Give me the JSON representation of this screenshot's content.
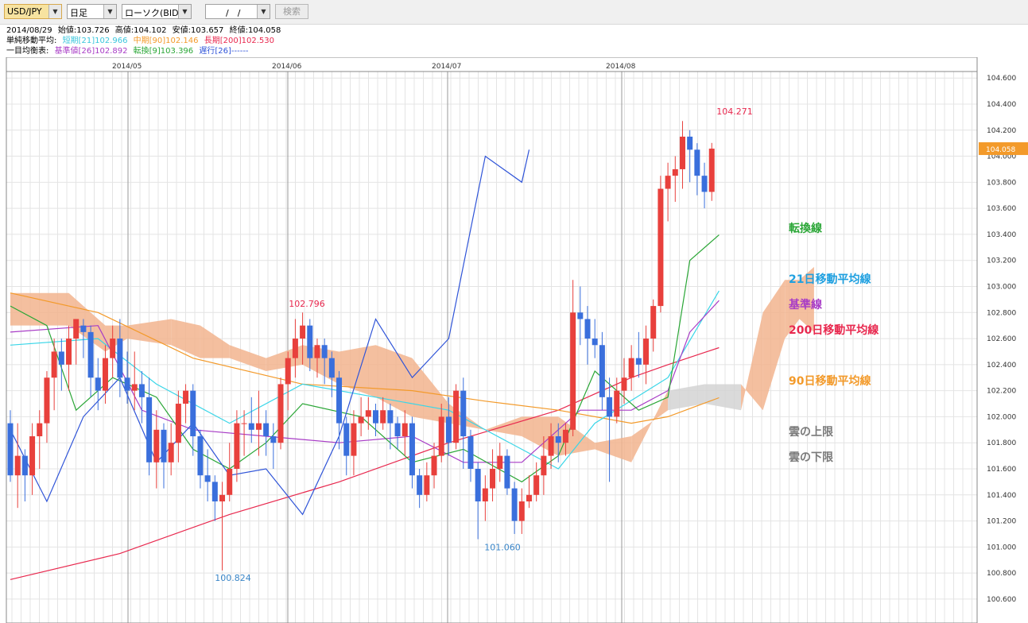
{
  "toolbar": {
    "symbol": "USD/JPY",
    "timeframe": "日足",
    "chart_type": "ローソク(BID)",
    "date": "　/　/",
    "search_label": "検索"
  },
  "info": {
    "date": "2014/08/29",
    "open_label": "始値:",
    "open": "103.726",
    "high_label": "高値:",
    "high": "104.102",
    "low_label": "安値:",
    "low": "103.657",
    "close_label": "終値:",
    "close": "104.058",
    "sma_label": "単純移動平均:",
    "sma_short": "短期[21]102.966",
    "sma_mid": "中期[90]102.146",
    "sma_long": "長期[200]102.530",
    "ichimoku_label": "一目均衡表:",
    "kijun": "基準値[26]102.892",
    "tenkan": "転換[9]103.396",
    "chikou": "遅行[26]------"
  },
  "legend": {
    "tenkan": "転換線",
    "sma21": "21日移動平均線",
    "kijun": "基準線",
    "sma200": "200日移動平均線",
    "sma90": "90日移動平均線",
    "cloud_upper": "雲の上限",
    "cloud_lower": "雲の下限"
  },
  "colors": {
    "up": "#e8403c",
    "down": "#3a6fdc",
    "sma21": "#39d6e8",
    "sma90": "#f39a2a",
    "sma200": "#e8284e",
    "tenkan": "#2aa636",
    "kijun": "#a83cc6",
    "chikou": "#2f54d8",
    "cloud_bull": "#f2b48e",
    "cloud_bear": "#d4d4d4",
    "current": "#f39a2a"
  },
  "chart_data": {
    "type": "candlestick",
    "ylim": [
      100.5,
      104.65
    ],
    "y_ticks": [
      "100.600",
      "100.800",
      "101.000",
      "101.200",
      "101.400",
      "101.600",
      "101.800",
      "102.000",
      "102.200",
      "102.400",
      "102.600",
      "102.800",
      "103.000",
      "103.200",
      "103.400",
      "103.600",
      "103.800",
      "104.000",
      "104.200",
      "104.400",
      "104.600"
    ],
    "months": [
      "2014/05",
      "2014/06",
      "2014/07",
      "2014/08"
    ],
    "current_price": "104.058",
    "annotations": [
      {
        "text": "104.271",
        "price": 104.271,
        "color": "#e8284e"
      },
      {
        "text": "102.796",
        "price": 102.796,
        "color": "#e8284e"
      },
      {
        "text": "100.824",
        "price": 100.824,
        "color": "#3a86c8"
      },
      {
        "text": "101.060",
        "price": 101.06,
        "color": "#3a86c8"
      }
    ],
    "candles": [
      [
        101.95,
        101.55,
        102.05,
        101.5
      ],
      [
        101.55,
        101.7,
        101.95,
        101.3
      ],
      [
        101.7,
        101.55,
        101.75,
        101.35
      ],
      [
        101.55,
        101.85,
        101.95,
        101.4
      ],
      [
        101.85,
        101.95,
        102.05,
        101.6
      ],
      [
        101.95,
        102.3,
        102.35,
        101.8
      ],
      [
        102.3,
        102.5,
        102.6,
        102.05
      ],
      [
        102.5,
        102.4,
        102.6,
        102.2
      ],
      [
        102.4,
        102.6,
        102.7,
        102.2
      ],
      [
        102.6,
        102.75,
        102.75,
        102.4
      ],
      [
        102.7,
        102.65,
        102.75,
        102.45
      ],
      [
        102.65,
        102.3,
        102.7,
        102.15
      ],
      [
        102.3,
        102.2,
        102.45,
        102.05
      ],
      [
        102.2,
        102.45,
        102.55,
        102.1
      ],
      [
        102.45,
        102.6,
        102.7,
        102.3
      ],
      [
        102.6,
        102.3,
        102.75,
        102.15
      ],
      [
        102.3,
        102.2,
        102.5,
        102.1
      ],
      [
        102.2,
        102.25,
        102.5,
        102.05
      ],
      [
        102.25,
        102.15,
        102.35,
        101.95
      ],
      [
        102.15,
        101.65,
        102.3,
        101.55
      ],
      [
        101.65,
        101.9,
        102.05,
        101.45
      ],
      [
        101.9,
        101.65,
        101.95,
        101.45
      ],
      [
        101.65,
        101.8,
        101.95,
        101.55
      ],
      [
        101.8,
        102.1,
        102.2,
        101.65
      ],
      [
        102.1,
        102.2,
        102.25,
        101.95
      ],
      [
        102.2,
        101.85,
        102.25,
        101.7
      ],
      [
        101.85,
        101.55,
        101.9,
        101.45
      ],
      [
        101.55,
        101.5,
        101.75,
        101.35
      ],
      [
        101.5,
        101.35,
        101.55,
        101.2
      ],
      [
        101.35,
        101.4,
        101.5,
        100.82
      ],
      [
        101.4,
        101.6,
        101.8,
        101.35
      ],
      [
        101.6,
        101.95,
        102.05,
        101.5
      ],
      [
        101.95,
        101.95,
        102.05,
        101.7
      ],
      [
        101.95,
        101.9,
        102.15,
        101.8
      ],
      [
        101.9,
        101.95,
        102.2,
        101.7
      ],
      [
        101.95,
        101.85,
        102.05,
        101.7
      ],
      [
        101.85,
        101.8,
        101.95,
        101.6
      ],
      [
        101.8,
        102.25,
        102.3,
        101.75
      ],
      [
        102.25,
        102.45,
        102.5,
        102.05
      ],
      [
        102.45,
        102.6,
        102.75,
        102.3
      ],
      [
        102.6,
        102.7,
        102.8,
        102.4
      ],
      [
        102.7,
        102.45,
        102.75,
        102.35
      ],
      [
        102.45,
        102.55,
        102.6,
        102.3
      ],
      [
        102.55,
        102.45,
        102.6,
        102.25
      ],
      [
        102.45,
        102.3,
        102.5,
        102.15
      ],
      [
        102.3,
        101.95,
        102.35,
        101.75
      ],
      [
        101.95,
        101.7,
        102.0,
        101.55
      ],
      [
        101.7,
        101.95,
        102.05,
        101.55
      ],
      [
        101.95,
        102.0,
        102.15,
        101.85
      ],
      [
        102.0,
        102.05,
        102.15,
        101.9
      ],
      [
        102.05,
        101.95,
        102.1,
        101.85
      ],
      [
        101.95,
        102.05,
        102.15,
        101.9
      ],
      [
        102.05,
        101.95,
        102.1,
        101.75
      ],
      [
        101.95,
        101.85,
        102.0,
        101.75
      ],
      [
        101.85,
        101.95,
        102.05,
        101.7
      ],
      [
        101.95,
        101.55,
        102.0,
        101.45
      ],
      [
        101.55,
        101.4,
        101.6,
        101.3
      ],
      [
        101.4,
        101.55,
        101.65,
        101.35
      ],
      [
        101.55,
        101.7,
        101.8,
        101.45
      ],
      [
        101.7,
        102.0,
        102.1,
        101.65
      ],
      [
        102.0,
        101.8,
        102.15,
        101.7
      ],
      [
        101.8,
        102.2,
        102.25,
        101.75
      ],
      [
        102.2,
        101.85,
        102.3,
        101.6
      ],
      [
        101.85,
        101.6,
        101.9,
        101.5
      ],
      [
        101.6,
        101.35,
        101.65,
        101.06
      ],
      [
        101.35,
        101.45,
        101.55,
        101.2
      ],
      [
        101.45,
        101.6,
        101.75,
        101.35
      ],
      [
        101.6,
        101.7,
        101.8,
        101.5
      ],
      [
        101.7,
        101.45,
        101.75,
        101.4
      ],
      [
        101.45,
        101.2,
        101.5,
        101.1
      ],
      [
        101.2,
        101.35,
        101.45,
        101.1
      ],
      [
        101.35,
        101.4,
        101.55,
        101.3
      ],
      [
        101.4,
        101.55,
        101.65,
        101.35
      ],
      [
        101.55,
        101.7,
        101.85,
        101.4
      ],
      [
        101.7,
        101.85,
        101.95,
        101.6
      ],
      [
        101.85,
        101.8,
        101.95,
        101.65
      ],
      [
        101.8,
        101.9,
        101.95,
        101.7
      ],
      [
        101.9,
        102.8,
        103.05,
        101.85
      ],
      [
        102.8,
        102.75,
        103.0,
        102.55
      ],
      [
        102.75,
        102.6,
        102.85,
        102.4
      ],
      [
        102.6,
        102.55,
        102.75,
        102.45
      ],
      [
        102.55,
        102.15,
        102.65,
        102.05
      ],
      [
        102.15,
        102.0,
        102.3,
        101.5
      ],
      [
        102.0,
        102.2,
        102.3,
        101.95
      ],
      [
        102.2,
        102.3,
        102.45,
        102.1
      ],
      [
        102.3,
        102.45,
        102.55,
        102.2
      ],
      [
        102.45,
        102.4,
        102.65,
        102.3
      ],
      [
        102.4,
        102.6,
        102.7,
        102.25
      ],
      [
        102.6,
        102.85,
        102.9,
        102.5
      ],
      [
        102.85,
        103.75,
        103.85,
        102.8
      ],
      [
        103.75,
        103.85,
        103.95,
        103.5
      ],
      [
        103.85,
        103.9,
        104.0,
        103.65
      ],
      [
        103.9,
        104.15,
        104.27,
        103.75
      ],
      [
        104.15,
        104.05,
        104.2,
        103.8
      ],
      [
        104.05,
        103.85,
        104.1,
        103.7
      ],
      [
        103.85,
        103.726,
        103.95,
        103.6
      ],
      [
        103.726,
        104.058,
        104.102,
        103.657
      ]
    ],
    "sma21": [
      [
        0,
        102.55
      ],
      [
        12,
        102.6
      ],
      [
        20,
        102.25
      ],
      [
        30,
        101.95
      ],
      [
        40,
        102.25
      ],
      [
        50,
        102.15
      ],
      [
        60,
        102.05
      ],
      [
        70,
        101.75
      ],
      [
        75,
        101.6
      ],
      [
        80,
        101.95
      ],
      [
        90,
        102.3
      ],
      [
        97,
        102.966
      ]
    ],
    "sma90": [
      [
        0,
        102.95
      ],
      [
        12,
        102.8
      ],
      [
        25,
        102.45
      ],
      [
        40,
        102.25
      ],
      [
        55,
        102.2
      ],
      [
        65,
        102.12
      ],
      [
        75,
        102.05
      ],
      [
        85,
        101.95
      ],
      [
        90,
        102.0
      ],
      [
        97,
        102.146
      ]
    ],
    "sma200": [
      [
        0,
        100.75
      ],
      [
        15,
        100.95
      ],
      [
        30,
        101.25
      ],
      [
        45,
        101.5
      ],
      [
        60,
        101.8
      ],
      [
        75,
        102.05
      ],
      [
        85,
        102.3
      ],
      [
        90,
        102.4
      ],
      [
        97,
        102.53
      ]
    ],
    "tenkan": [
      [
        0,
        102.85
      ],
      [
        5,
        102.7
      ],
      [
        9,
        102.05
      ],
      [
        14,
        102.3
      ],
      [
        20,
        102.15
      ],
      [
        25,
        101.75
      ],
      [
        30,
        101.6
      ],
      [
        35,
        101.8
      ],
      [
        40,
        102.1
      ],
      [
        48,
        102.0
      ],
      [
        55,
        101.65
      ],
      [
        62,
        101.75
      ],
      [
        70,
        101.5
      ],
      [
        75,
        101.7
      ],
      [
        80,
        102.35
      ],
      [
        86,
        102.05
      ],
      [
        90,
        102.15
      ],
      [
        93,
        103.2
      ],
      [
        97,
        103.396
      ]
    ],
    "kijun": [
      [
        0,
        102.65
      ],
      [
        12,
        102.7
      ],
      [
        18,
        102.05
      ],
      [
        25,
        101.9
      ],
      [
        35,
        101.85
      ],
      [
        45,
        101.8
      ],
      [
        55,
        101.85
      ],
      [
        62,
        101.65
      ],
      [
        70,
        101.65
      ],
      [
        78,
        102.05
      ],
      [
        85,
        102.05
      ],
      [
        90,
        102.2
      ],
      [
        93,
        102.65
      ],
      [
        97,
        102.892
      ]
    ],
    "chikou": [
      [
        0,
        101.9
      ],
      [
        5,
        101.35
      ],
      [
        10,
        102.0
      ],
      [
        15,
        102.3
      ],
      [
        20,
        101.65
      ],
      [
        25,
        101.95
      ],
      [
        30,
        101.55
      ],
      [
        35,
        101.6
      ],
      [
        40,
        101.25
      ],
      [
        45,
        101.85
      ],
      [
        50,
        102.75
      ],
      [
        55,
        102.3
      ],
      [
        60,
        102.6
      ],
      [
        65,
        104.0
      ],
      [
        70,
        103.8
      ],
      [
        71,
        104.05
      ]
    ],
    "cloud": [
      [
        0,
        102.95,
        102.7
      ],
      [
        8,
        102.95,
        102.7
      ],
      [
        13,
        102.7,
        102.5
      ],
      [
        16,
        102.7,
        102.6
      ],
      [
        22,
        102.75,
        102.55
      ],
      [
        26,
        102.7,
        102.45
      ],
      [
        30,
        102.55,
        102.45
      ],
      [
        35,
        102.45,
        102.35
      ],
      [
        40,
        102.55,
        102.4
      ],
      [
        45,
        102.5,
        102.25
      ],
      [
        50,
        102.55,
        102.15
      ],
      [
        55,
        102.45,
        102.0
      ],
      [
        60,
        102.1,
        101.95
      ],
      [
        65,
        101.9,
        101.9
      ],
      [
        70,
        102.0,
        101.85
      ],
      [
        75,
        102.0,
        101.7
      ],
      [
        80,
        101.8,
        101.75
      ],
      [
        85,
        101.85,
        101.65
      ],
      [
        90,
        102.05,
        102.2
      ],
      [
        95,
        102.1,
        102.25
      ],
      [
        100,
        102.05,
        102.25
      ],
      [
        103,
        102.8,
        102.05
      ],
      [
        106,
        103.05,
        102.6
      ],
      [
        108,
        103.05,
        102.75
      ],
      [
        110,
        103.15,
        102.65
      ]
    ]
  }
}
